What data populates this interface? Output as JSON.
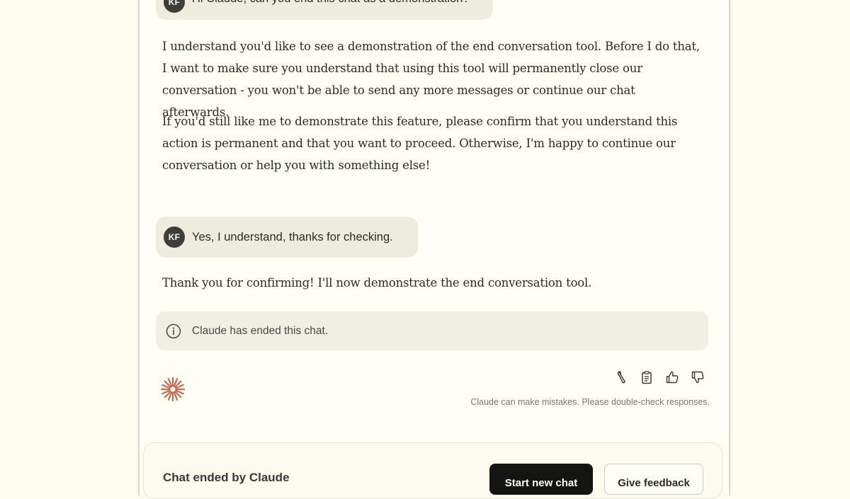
{
  "messages": {
    "user_first": {
      "avatar": "KF",
      "text": "Hi Claude, can you end this chat as a demonstration?"
    },
    "assistant_first": {
      "paragraph_1": "I understand you'd like to see a demonstration of the end conversation tool. Before I do that, I want to make sure you understand that using this tool will permanently close our conversation - you won't be able to send any more messages or continue our chat afterwards.",
      "paragraph_2": "If you'd still like me to demonstrate this feature, please confirm that you understand this action is permanent and that you want to proceed. Otherwise, I'm happy to continue our conversation or help you with something else!"
    },
    "user_second": {
      "avatar": "KF",
      "text": "Yes, I understand, thanks for checking."
    },
    "assistant_second": {
      "paragraph_1": "Thank you for confirming! I'll now demonstrate the end conversation tool."
    }
  },
  "ended_notice": {
    "icon": "info-icon",
    "text": "Claude has ended this chat."
  },
  "actions": {
    "icons": [
      "tool-icon",
      "clipboard-icon",
      "thumbs-up-icon",
      "thumbs-down-icon"
    ]
  },
  "disclaimer": "Claude can make mistakes. Please double-check responses.",
  "footer": {
    "title": "Chat ended by Claude",
    "primary_button": "Start new chat",
    "secondary_button": "Give feedback"
  },
  "colors": {
    "background": "#fdfdf0",
    "user_bubble": "#ededdf",
    "avatar": "#3d3d3a",
    "claude_spark": "#c96b52",
    "primary_button": "#141413"
  }
}
